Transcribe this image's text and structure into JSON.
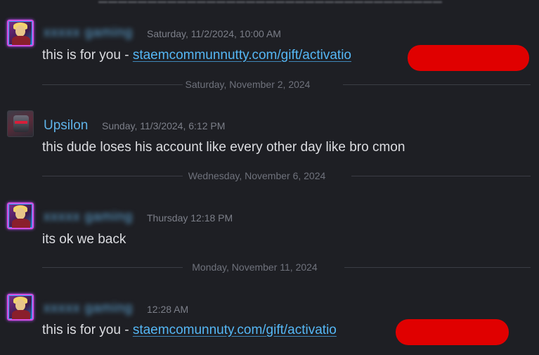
{
  "messages": [
    {
      "author": "xxxxx gaming",
      "timestamp": "Saturday, 11/2/2024, 10:00 AM",
      "text_prefix": "this is for you - ",
      "link": "staemcommunnutty.com/gift/activatio"
    },
    {
      "author": "Upsilon",
      "timestamp": "Sunday, 11/3/2024, 6:12 PM",
      "text": "this dude loses his account like every other day like bro cmon"
    },
    {
      "author": "xxxxx gaming",
      "timestamp": "Thursday 12:18 PM",
      "text": "its ok we back"
    },
    {
      "author": "xxxxx gaming",
      "timestamp": "12:28 AM",
      "text_prefix": "this is for you - ",
      "link": "staemcomunnuty.com/gift/activatio"
    }
  ],
  "dividers": [
    "Saturday, November 2, 2024",
    "Wednesday, November 6, 2024",
    "Monday, November 11, 2024"
  ],
  "colors": {
    "background": "#1e1f24",
    "username": "#5fb3e8",
    "link": "#55b7f5",
    "redaction": "#e00000",
    "avatar_frame": "#d44ee0"
  }
}
